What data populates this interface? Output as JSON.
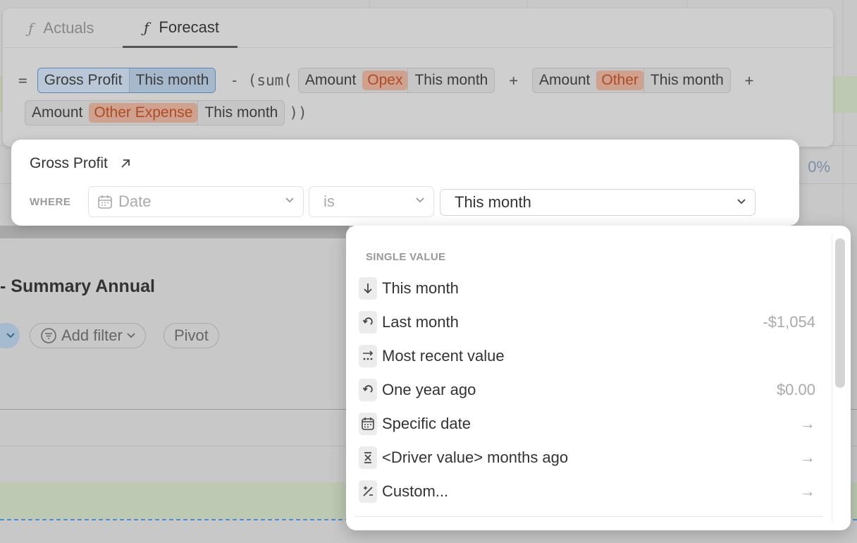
{
  "formula_editor": {
    "tabs": [
      {
        "label": "Actuals",
        "icon": "function-icon"
      },
      {
        "label": "Forecast",
        "icon": "function-icon"
      }
    ],
    "active_tab": "Forecast",
    "equals": "=",
    "minus": "- (sum(",
    "plus": "+",
    "close": "))",
    "tokens": {
      "gross_profit": {
        "name": "Gross Profit",
        "period": "This month"
      },
      "opex": {
        "name": "Amount",
        "tag": "Opex",
        "period": "This month"
      },
      "other": {
        "name": "Amount",
        "tag": "Other",
        "period": "This month"
      },
      "other_expense": {
        "name": "Amount",
        "tag": "Other Expense",
        "period": "This month"
      }
    }
  },
  "reference_popover": {
    "title": "Gross Profit",
    "where_label": "WHERE",
    "field_placeholder": "Date",
    "operator_placeholder": "is",
    "value": "This month"
  },
  "dropdown": {
    "section": "SINGLE VALUE",
    "items": [
      {
        "label": "This month",
        "icon": "arrow-down-icon",
        "right": ""
      },
      {
        "label": "Last month",
        "icon": "undo-icon",
        "right": "-$1,054"
      },
      {
        "label": "Most recent value",
        "icon": "recent-value-icon",
        "right": ""
      },
      {
        "label": "One year ago",
        "icon": "undo-icon",
        "right": "$0.00"
      },
      {
        "label": "Specific date",
        "icon": "calendar-icon",
        "right": "→"
      },
      {
        "label": "<Driver value> months ago",
        "icon": "hourglass-icon",
        "right": "→"
      },
      {
        "label": "Custom...",
        "icon": "custom-icon",
        "right": "→"
      }
    ]
  },
  "background": {
    "title": "- Summary Annual",
    "add_filter": "Add filter",
    "pivot": "Pivot",
    "percent": "0%"
  },
  "colors": {
    "accent_blue": "#5a87b8",
    "tag_orange": "#cfa28f",
    "row_green": "#bdc9b2"
  }
}
